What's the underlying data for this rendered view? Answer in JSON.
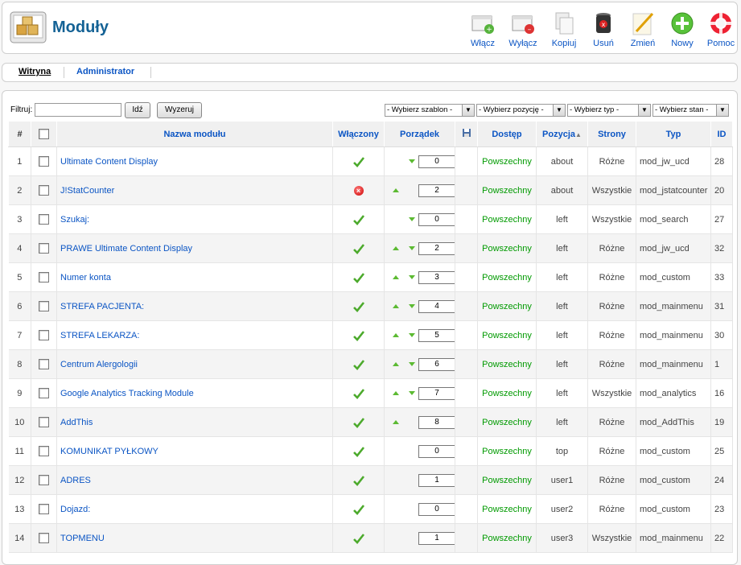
{
  "header": {
    "title": "Moduły",
    "toolbar": [
      {
        "label": "Włącz",
        "icon": "enable-icon"
      },
      {
        "label": "Wyłącz",
        "icon": "disable-icon"
      },
      {
        "label": "Kopiuj",
        "icon": "copy-icon"
      },
      {
        "label": "Usuń",
        "icon": "trash-icon"
      },
      {
        "label": "Zmień",
        "icon": "edit-icon"
      },
      {
        "label": "Nowy",
        "icon": "new-icon"
      },
      {
        "label": "Pomoc",
        "icon": "help-icon"
      }
    ]
  },
  "submenu": {
    "items": [
      "Witryna",
      "Administrator"
    ]
  },
  "filter": {
    "label": "Filtruj:",
    "value": "",
    "go_label": "Idź",
    "reset_label": "Wyzeruj",
    "selects": [
      "- Wybierz szablon -",
      "- Wybierz pozycję -",
      "- Wybierz typ -",
      "- Wybierz stan -"
    ]
  },
  "table": {
    "headers": {
      "num": "#",
      "name": "Nazwa modułu",
      "enabled": "Włączony",
      "order": "Porządek",
      "access": "Dostęp",
      "position": "Pozycja",
      "pages": "Strony",
      "type": "Typ",
      "id": "ID"
    },
    "rows": [
      {
        "num": "1",
        "name": "Ultimate Content Display",
        "enabled": true,
        "up": false,
        "down": true,
        "order": "0",
        "access": "Powszechny",
        "position": "about",
        "pages": "Różne",
        "type": "mod_jw_ucd",
        "id": "28"
      },
      {
        "num": "2",
        "name": "J!StatCounter",
        "enabled": false,
        "up": true,
        "down": false,
        "order": "2",
        "access": "Powszechny",
        "position": "about",
        "pages": "Wszystkie",
        "type": "mod_jstatcounter",
        "id": "20"
      },
      {
        "num": "3",
        "name": "Szukaj:",
        "enabled": true,
        "up": false,
        "down": true,
        "order": "0",
        "access": "Powszechny",
        "position": "left",
        "pages": "Wszystkie",
        "type": "mod_search",
        "id": "27"
      },
      {
        "num": "4",
        "name": "PRAWE Ultimate Content Display",
        "enabled": true,
        "up": true,
        "down": true,
        "order": "2",
        "access": "Powszechny",
        "position": "left",
        "pages": "Różne",
        "type": "mod_jw_ucd",
        "id": "32"
      },
      {
        "num": "5",
        "name": "Numer konta",
        "enabled": true,
        "up": true,
        "down": true,
        "order": "3",
        "access": "Powszechny",
        "position": "left",
        "pages": "Różne",
        "type": "mod_custom",
        "id": "33"
      },
      {
        "num": "6",
        "name": "STREFA PACJENTA:",
        "enabled": true,
        "up": true,
        "down": true,
        "order": "4",
        "access": "Powszechny",
        "position": "left",
        "pages": "Różne",
        "type": "mod_mainmenu",
        "id": "31"
      },
      {
        "num": "7",
        "name": "STREFA LEKARZA:",
        "enabled": true,
        "up": true,
        "down": true,
        "order": "5",
        "access": "Powszechny",
        "position": "left",
        "pages": "Różne",
        "type": "mod_mainmenu",
        "id": "30"
      },
      {
        "num": "8",
        "name": "Centrum Alergologii",
        "enabled": true,
        "up": true,
        "down": true,
        "order": "6",
        "access": "Powszechny",
        "position": "left",
        "pages": "Różne",
        "type": "mod_mainmenu",
        "id": "1"
      },
      {
        "num": "9",
        "name": "Google Analytics Tracking Module",
        "enabled": true,
        "up": true,
        "down": true,
        "order": "7",
        "access": "Powszechny",
        "position": "left",
        "pages": "Wszystkie",
        "type": "mod_analytics",
        "id": "16"
      },
      {
        "num": "10",
        "name": "AddThis",
        "enabled": true,
        "up": true,
        "down": false,
        "order": "8",
        "access": "Powszechny",
        "position": "left",
        "pages": "Różne",
        "type": "mod_AddThis",
        "id": "19"
      },
      {
        "num": "11",
        "name": "KOMUNIKAT PYŁKOWY",
        "enabled": true,
        "up": false,
        "down": false,
        "order": "0",
        "access": "Powszechny",
        "position": "top",
        "pages": "Różne",
        "type": "mod_custom",
        "id": "25"
      },
      {
        "num": "12",
        "name": "ADRES",
        "enabled": true,
        "up": false,
        "down": false,
        "order": "1",
        "access": "Powszechny",
        "position": "user1",
        "pages": "Różne",
        "type": "mod_custom",
        "id": "24"
      },
      {
        "num": "13",
        "name": "Dojazd:",
        "enabled": true,
        "up": false,
        "down": false,
        "order": "0",
        "access": "Powszechny",
        "position": "user2",
        "pages": "Różne",
        "type": "mod_custom",
        "id": "23"
      },
      {
        "num": "14",
        "name": "TOPMENU",
        "enabled": true,
        "up": false,
        "down": false,
        "order": "1",
        "access": "Powszechny",
        "position": "user3",
        "pages": "Wszystkie",
        "type": "mod_mainmenu",
        "id": "22"
      }
    ]
  },
  "colors": {
    "link": "#0b55c4",
    "title": "#146295",
    "access": "#009a00",
    "enabled_green": "#5cba32",
    "disabled_red": "#cc0000"
  }
}
